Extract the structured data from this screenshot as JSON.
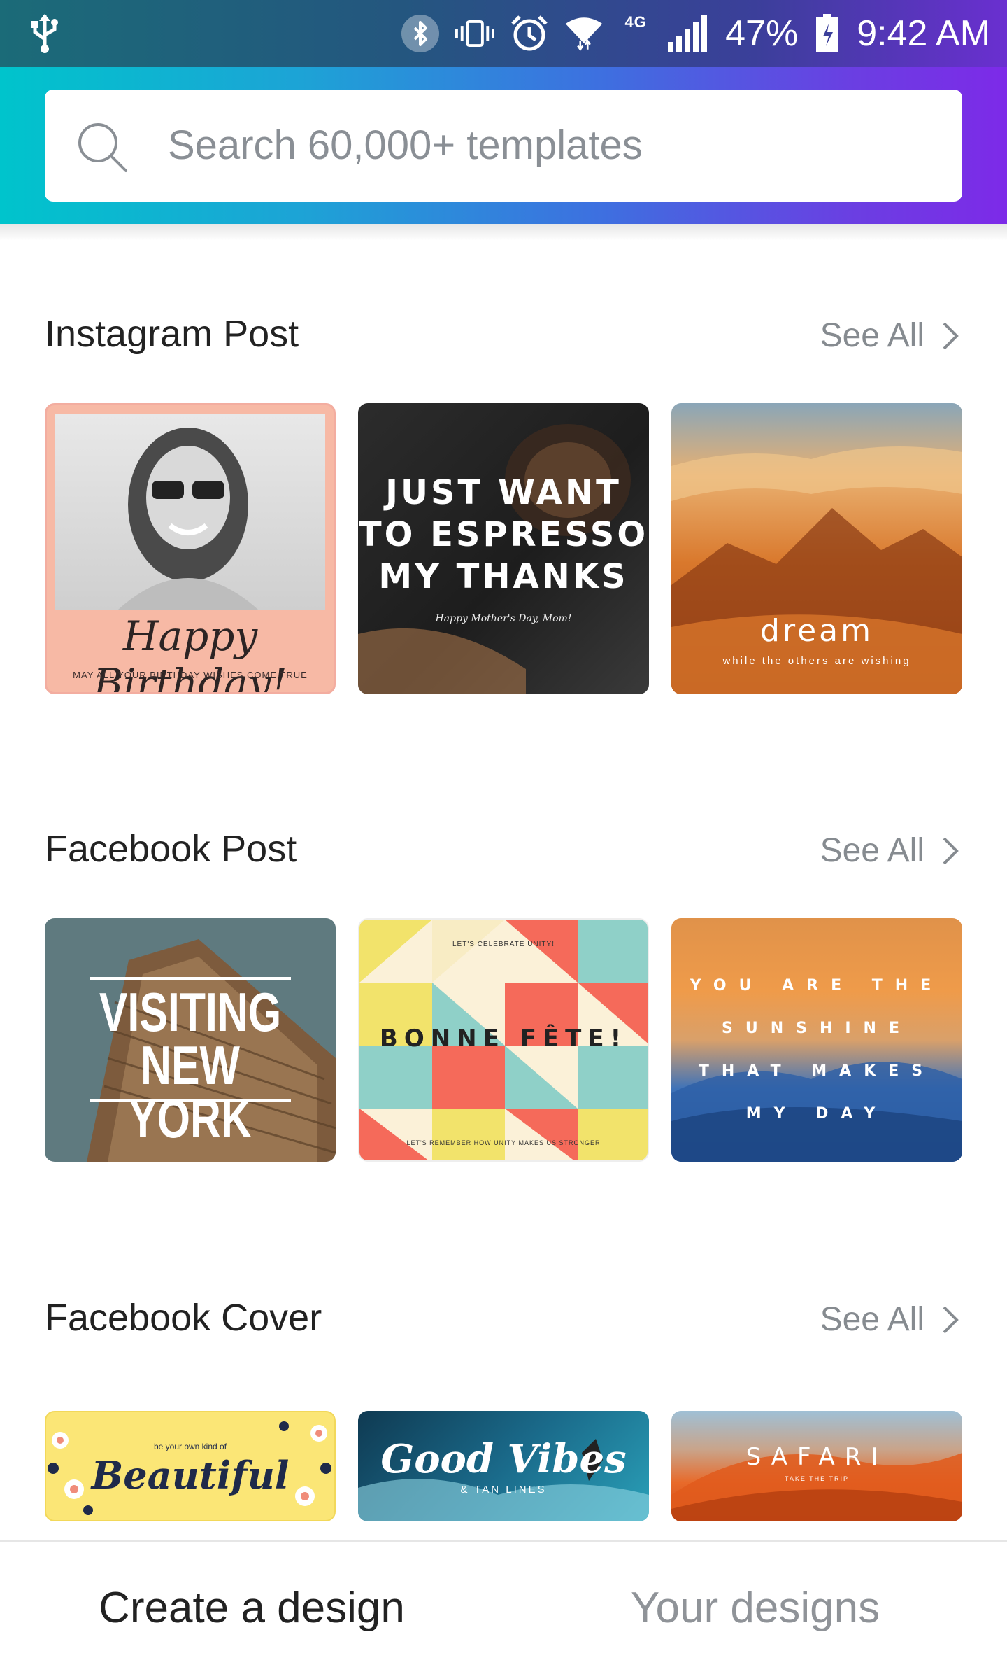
{
  "status_bar": {
    "icons": [
      "usb-icon",
      "bluetooth-icon",
      "vibrate-icon",
      "alarm-icon",
      "wifi-icon",
      "lte-icon",
      "signal-icon",
      "battery-icon"
    ],
    "network": "4G",
    "battery": "47%",
    "time": "9:42 AM"
  },
  "search": {
    "placeholder": "Search 60,000+ templates",
    "icon": "search-icon"
  },
  "sections": [
    {
      "title": "Instagram Post",
      "see_all": "See All",
      "cards": [
        {
          "title": "Happy Birthday!",
          "subtitle": "MAY ALL YOUR BIRTHDAY WISHES COME TRUE"
        },
        {
          "title_lines": [
            "JUST WANT",
            "TO ESPRESSO",
            "MY THANKS"
          ],
          "subtitle": "Happy Mother's Day, Mom!"
        },
        {
          "title": "dream",
          "subtitle": "while the others are wishing"
        }
      ]
    },
    {
      "title": "Facebook Post",
      "see_all": "See All",
      "cards": [
        {
          "title_lines": [
            "VISITING",
            "NEW YORK"
          ]
        },
        {
          "top": "LET'S CELEBRATE UNITY!",
          "title": "BONNE FÊTE!",
          "bottom": "LET'S REMEMBER HOW UNITY MAKES US STRONGER"
        },
        {
          "title_lines": [
            "YOU ARE THE",
            "SUNSHINE",
            "THAT MAKES",
            "MY DAY"
          ]
        }
      ]
    },
    {
      "title": "Facebook Cover",
      "see_all": "See All",
      "cards": [
        {
          "top": "be your own kind of",
          "title": "Beautiful"
        },
        {
          "title": "Good Vibes",
          "subtitle": "& TAN LINES"
        },
        {
          "title": "SAFARI",
          "subtitle": "TAKE THE TRIP"
        }
      ]
    }
  ],
  "bottom_nav": {
    "tabs": [
      "Create a design",
      "Your designs"
    ],
    "active": "Create a design"
  },
  "colors": {
    "brand_gradient_start": "#00c4cc",
    "brand_gradient_end": "#7d2ae8"
  }
}
